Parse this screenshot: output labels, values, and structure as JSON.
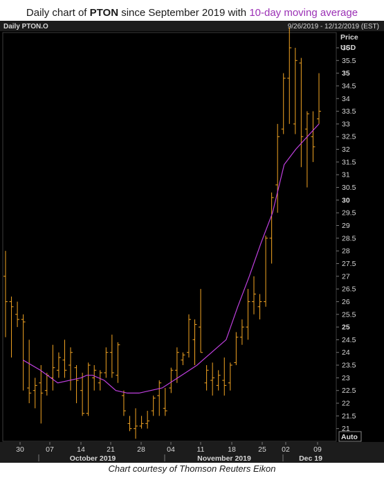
{
  "title": {
    "prefix": "Daily chart of ",
    "ticker": "PTON",
    "middle": " since September 2019 with ",
    "ma_label": "10-day moving average"
  },
  "header": {
    "symbol": "Daily PTON.O",
    "date_range": "9/26/2019 - 12/12/2019 (EST)"
  },
  "axis": {
    "price_label": "Price",
    "currency_label": "USD",
    "auto_label": "Auto"
  },
  "caption": "Chart courtesy of Thomson Reuters Eikon",
  "colors": {
    "background": "#000000",
    "bars": "#f5a623",
    "moving_average": "#c040e0",
    "text": "#d8d8d8",
    "title_ma": "#9b30b5"
  },
  "chart_data": {
    "type": "ohlc",
    "title": "Daily chart of PTON since September 2019 with 10-day moving average",
    "ylabel": "Price USD",
    "ylim": [
      20.5,
      36.6
    ],
    "y_ticks": [
      21,
      21.5,
      22,
      22.5,
      23,
      23.5,
      24,
      24.5,
      25,
      25.5,
      26,
      26.5,
      27,
      27.5,
      28,
      28.5,
      29,
      29.5,
      30,
      30.5,
      31,
      31.5,
      32,
      32.5,
      33,
      33.5,
      34,
      34.5,
      35,
      35.5,
      36
    ],
    "y_ticks_bold": [
      25,
      30,
      35
    ],
    "x_day_labels": [
      {
        "label": "30",
        "index": 2
      },
      {
        "label": "07",
        "index": 7
      },
      {
        "label": "14",
        "index": 12
      },
      {
        "label": "21",
        "index": 17
      },
      {
        "label": "28",
        "index": 22
      },
      {
        "label": "04",
        "index": 27
      },
      {
        "label": "11",
        "index": 32
      },
      {
        "label": "18",
        "index": 37
      },
      {
        "label": "25",
        "index": 42
      },
      {
        "label": "02",
        "index": 46
      },
      {
        "label": "09",
        "index": 51
      }
    ],
    "x_month_labels": [
      {
        "label": "October 2019",
        "start": 3,
        "end": 25
      },
      {
        "label": "November 2019",
        "start": 26,
        "end": 45
      },
      {
        "label": "Dec 19",
        "start": 46,
        "end": 53
      }
    ],
    "ohlc": [
      {
        "h": 28.0,
        "l": 25.5,
        "o": 27.0,
        "c": 26.0
      },
      {
        "h": 26.3,
        "l": 23.8,
        "o": 26.1,
        "c": 25.8
      },
      {
        "h": 26.0,
        "l": 25.0,
        "o": 25.5,
        "c": 25.3
      },
      {
        "h": 25.5,
        "l": 22.5,
        "o": 25.3,
        "c": 25.2
      },
      {
        "h": 24.5,
        "l": 22.0,
        "o": 22.6,
        "c": 22.4
      },
      {
        "h": 23.0,
        "l": 21.8,
        "o": 22.5,
        "c": 22.7
      },
      {
        "h": 23.5,
        "l": 21.2,
        "o": 22.8,
        "c": 22.4
      },
      {
        "h": 23.2,
        "l": 22.3,
        "o": 22.5,
        "c": 23.1
      },
      {
        "h": 24.3,
        "l": 22.5,
        "o": 23.0,
        "c": 23.4
      },
      {
        "h": 24.0,
        "l": 23.0,
        "o": 23.3,
        "c": 23.8
      },
      {
        "h": 24.5,
        "l": 23.0,
        "o": 23.7,
        "c": 23.3
      },
      {
        "h": 24.2,
        "l": 22.5,
        "o": 23.5,
        "c": 24.0
      },
      {
        "h": 23.5,
        "l": 22.0,
        "o": 23.4,
        "c": 22.9
      },
      {
        "h": 23.2,
        "l": 21.5,
        "o": 22.5,
        "c": 21.6
      },
      {
        "h": 23.6,
        "l": 21.5,
        "o": 21.6,
        "c": 23.5
      },
      {
        "h": 23.5,
        "l": 22.5,
        "o": 23.0,
        "c": 23.3
      },
      {
        "h": 23.3,
        "l": 22.5,
        "o": 22.8,
        "c": 23.2
      },
      {
        "h": 24.2,
        "l": 23.0,
        "o": 23.2,
        "c": 24.0
      },
      {
        "h": 24.7,
        "l": 23.0,
        "o": 24.0,
        "c": 23.2
      },
      {
        "h": 24.4,
        "l": 22.8,
        "o": 23.1,
        "c": 24.3
      },
      {
        "h": 22.5,
        "l": 21.5,
        "o": 22.3,
        "c": 21.7
      },
      {
        "h": 21.5,
        "l": 20.9,
        "o": 21.2,
        "c": 21.0
      },
      {
        "h": 21.8,
        "l": 20.6,
        "o": 21.0,
        "c": 21.1
      },
      {
        "h": 21.5,
        "l": 21.0,
        "o": 21.1,
        "c": 21.2
      },
      {
        "h": 21.7,
        "l": 21.0,
        "o": 21.2,
        "c": 21.3
      },
      {
        "h": 22.3,
        "l": 21.5,
        "o": 21.7,
        "c": 22.2
      },
      {
        "h": 22.9,
        "l": 21.5,
        "o": 22.3,
        "c": 22.8
      },
      {
        "h": 22.6,
        "l": 21.5,
        "o": 21.8,
        "c": 21.7
      },
      {
        "h": 23.4,
        "l": 22.4,
        "o": 22.6,
        "c": 23.3
      },
      {
        "h": 24.2,
        "l": 22.8,
        "o": 23.3,
        "c": 24.0
      },
      {
        "h": 24.0,
        "l": 23.5,
        "o": 23.7,
        "c": 23.9
      },
      {
        "h": 25.5,
        "l": 23.8,
        "o": 24.0,
        "c": 25.3
      },
      {
        "h": 25.3,
        "l": 23.5,
        "o": 24.5,
        "c": 25.1
      },
      {
        "h": 26.5,
        "l": 24.0,
        "o": 25.0,
        "c": 24.0
      },
      {
        "h": 23.5,
        "l": 22.5,
        "o": 22.8,
        "c": 23.3
      },
      {
        "h": 23.6,
        "l": 22.3,
        "o": 22.9,
        "c": 23.0
      },
      {
        "h": 23.3,
        "l": 22.5,
        "o": 22.7,
        "c": 23.1
      },
      {
        "h": 23.8,
        "l": 22.3,
        "o": 22.9,
        "c": 22.7
      },
      {
        "h": 23.6,
        "l": 22.5,
        "o": 22.8,
        "c": 23.5
      }
    ],
    "ohlc_note_placeholder": "",
    "moving_average": [
      [
        3,
        23.7
      ],
      [
        6,
        23.3
      ],
      [
        9,
        22.8
      ],
      [
        13,
        23.0
      ],
      [
        14,
        23.1
      ],
      [
        15,
        23.1
      ],
      [
        17,
        22.9
      ],
      [
        19,
        22.5
      ],
      [
        21,
        22.4
      ],
      [
        23,
        22.4
      ],
      [
        25,
        22.5
      ],
      [
        27,
        22.6
      ],
      [
        29,
        22.9
      ],
      [
        31,
        23.2
      ],
      [
        33,
        23.5
      ],
      [
        34,
        23.7
      ],
      [
        36,
        24.1
      ],
      [
        38,
        24.5
      ],
      [
        40,
        25.8
      ],
      [
        42,
        27.0
      ],
      [
        44,
        28.3
      ],
      [
        46,
        29.5
      ],
      [
        48,
        31.4
      ],
      [
        50,
        32.0
      ],
      [
        52,
        32.5
      ],
      [
        54,
        33.0
      ]
    ]
  }
}
